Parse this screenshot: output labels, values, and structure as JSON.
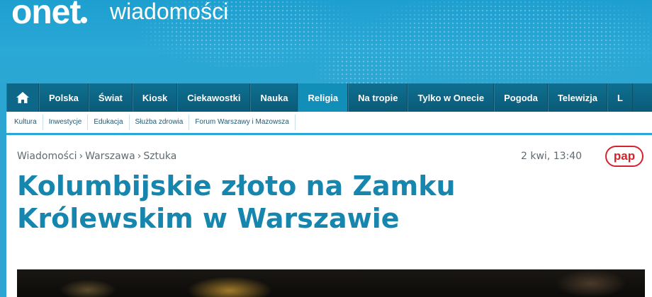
{
  "header": {
    "logo_text": "onet",
    "section_name": "wiadomości"
  },
  "nav": {
    "home_icon": "home-icon",
    "items": [
      "Polska",
      "Świat",
      "Kiosk",
      "Ciekawostki",
      "Nauka",
      "Religia",
      "Na tropie",
      "Tylko w Onecie",
      "Pogoda",
      "Telewizja",
      "L"
    ],
    "active_index": 5
  },
  "subnav": {
    "items": [
      "Kultura",
      "Inwestycje",
      "Edukacja",
      "Służba zdrowia",
      "Forum Warszawy i Mazowsza"
    ]
  },
  "article": {
    "breadcrumb": [
      "Wiadomości",
      "Warszawa",
      "Sztuka"
    ],
    "breadcrumb_separator": "›",
    "date": "2 kwi, 13:40",
    "source_badge": "pap",
    "title": "Kolumbijskie złoto na Zamku Królewskim w Warszawie"
  },
  "colors": {
    "header_blue": "#2aa8d6",
    "nav_dark": "#0a5b78",
    "title_blue": "#1786ae",
    "pap_red": "#d6222a"
  }
}
